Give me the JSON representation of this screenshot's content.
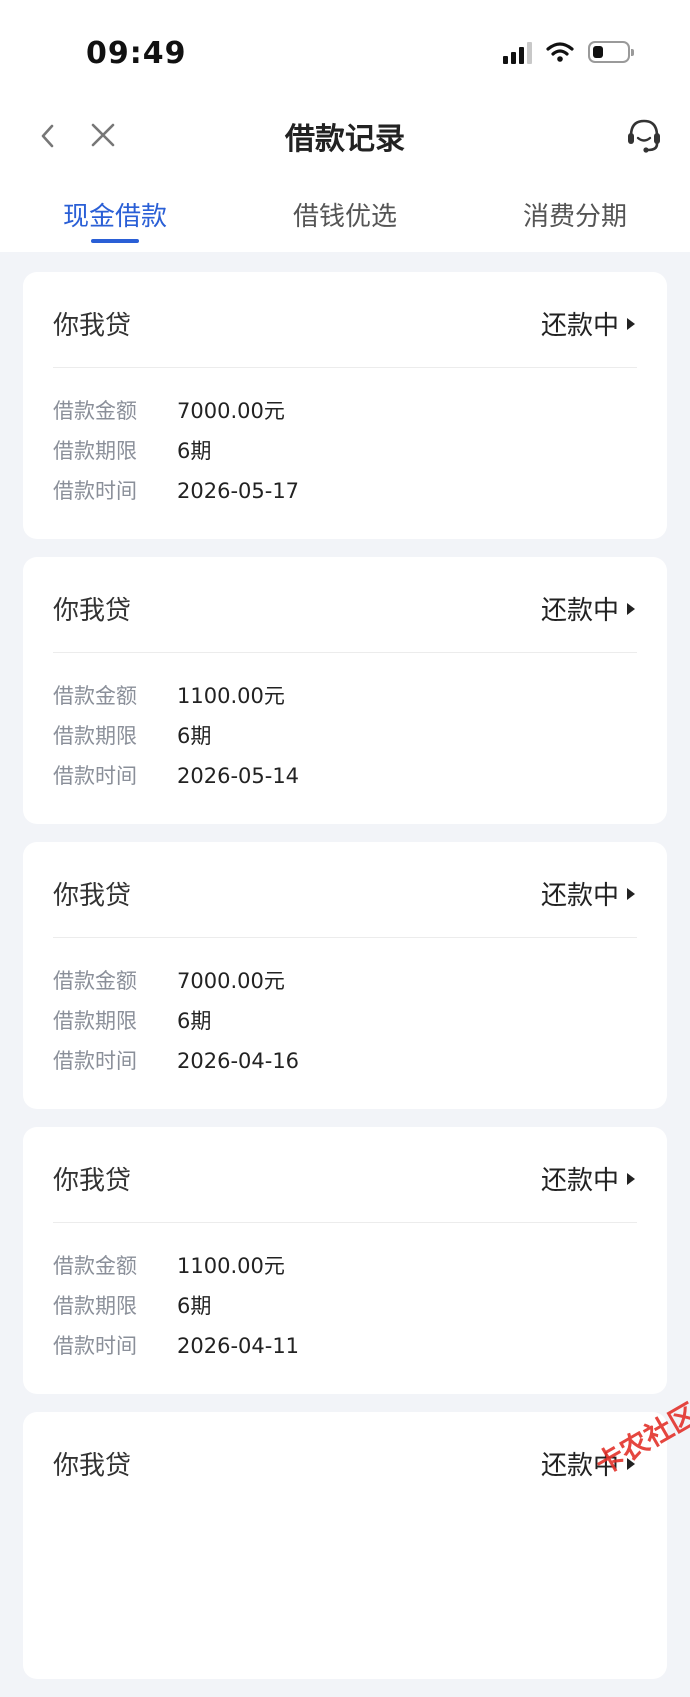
{
  "status_bar": {
    "time": "09:49",
    "battery_level": 0.3
  },
  "nav": {
    "title": "借款记录"
  },
  "tabs": [
    {
      "label": "现金借款",
      "active": true
    },
    {
      "label": "借钱优选",
      "active": false
    },
    {
      "label": "消费分期",
      "active": false
    }
  ],
  "labels": {
    "amount": "借款金额",
    "term": "借款期限",
    "date": "借款时间"
  },
  "records": [
    {
      "name": "你我贷",
      "status": "还款中",
      "amount": "7000.00元",
      "term": "6期",
      "date": "2026-05-17"
    },
    {
      "name": "你我贷",
      "status": "还款中",
      "amount": "1100.00元",
      "term": "6期",
      "date": "2026-05-14"
    },
    {
      "name": "你我贷",
      "status": "还款中",
      "amount": "7000.00元",
      "term": "6期",
      "date": "2026-04-16"
    },
    {
      "name": "你我贷",
      "status": "还款中",
      "amount": "1100.00元",
      "term": "6期",
      "date": "2026-04-11"
    },
    {
      "name": "你我贷",
      "status": "还款中"
    }
  ],
  "watermark": "卡农社区",
  "colors": {
    "accent": "#2a5fd6",
    "background": "#f2f4f8",
    "watermark": "#e3322b"
  }
}
